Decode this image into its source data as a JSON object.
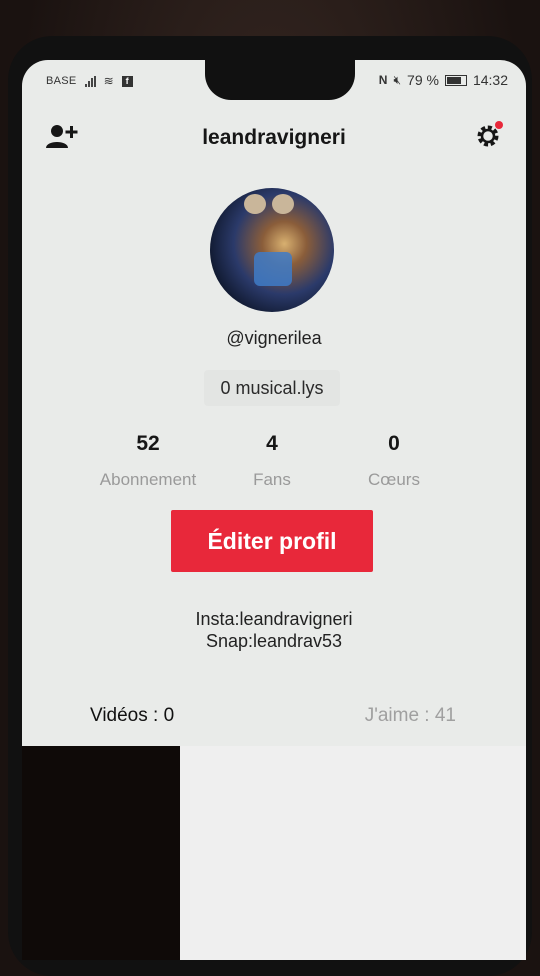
{
  "status_bar": {
    "carrier": "BASE",
    "battery": "79 %",
    "time": "14:32"
  },
  "header": {
    "title": "leandravigneri"
  },
  "profile": {
    "handle": "@vignerilea",
    "musicals": "0 musical.lys",
    "stats": [
      {
        "value": "52",
        "label": "Abonnement"
      },
      {
        "value": "4",
        "label": "Fans"
      },
      {
        "value": "0",
        "label": "Cœurs"
      }
    ],
    "edit_button": "Éditer profil",
    "bio": [
      "Insta:leandravigneri",
      "Snap:leandrav53"
    ]
  },
  "tabs": {
    "videos": "Vidéos : 0",
    "likes": "J'aime : 41"
  },
  "icons": {
    "add_user": "add-user-icon",
    "settings": "gear-icon",
    "notification_dot_color": "#e8283a"
  },
  "colors": {
    "accent": "#e8283a",
    "background": "#e9ebe9"
  }
}
